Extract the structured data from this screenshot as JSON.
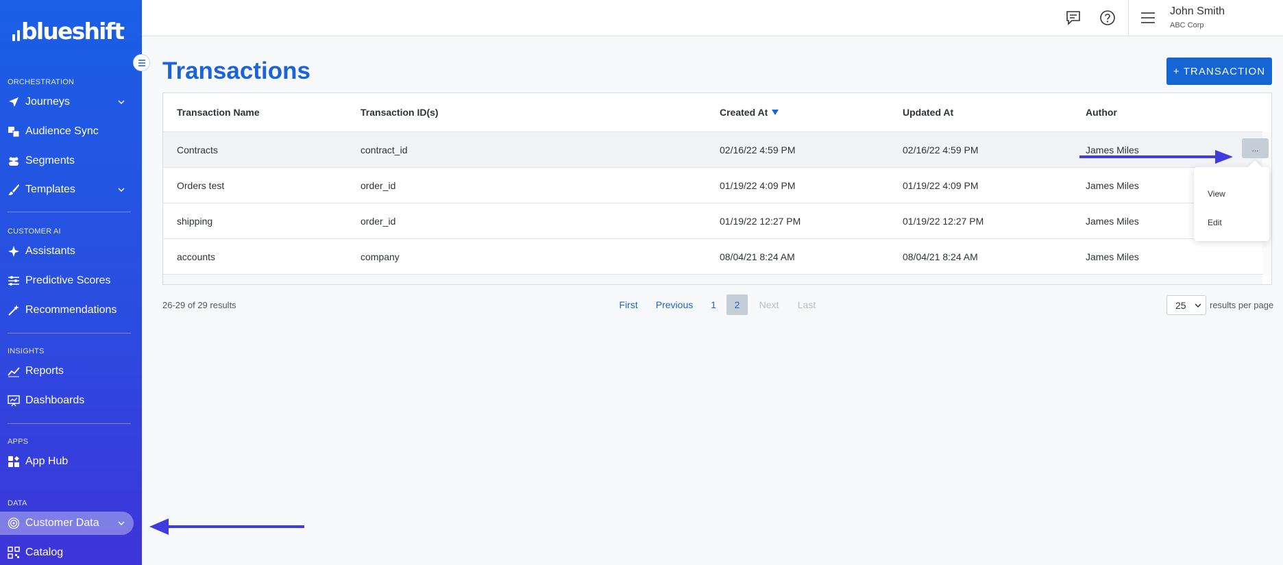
{
  "brand": {
    "logo_text": "blueshift"
  },
  "sidebar": {
    "sections": {
      "orchestration": "ORCHESTRATION",
      "customer_ai": "CUSTOMER AI",
      "insights": "INSIGHTS",
      "apps": "APPS",
      "data": "DATA"
    },
    "items": [
      {
        "label": "Journeys",
        "icon": "send-icon",
        "has_chevron": true
      },
      {
        "label": "Audience Sync",
        "icon": "audience-sync-icon",
        "has_chevron": false
      },
      {
        "label": "Segments",
        "icon": "users-icon",
        "has_chevron": false
      },
      {
        "label": "Templates",
        "icon": "brush-icon",
        "has_chevron": true
      },
      {
        "label": "Assistants",
        "icon": "sparkle-icon",
        "has_chevron": false
      },
      {
        "label": "Predictive Scores",
        "icon": "sliders-icon",
        "has_chevron": false
      },
      {
        "label": "Recommendations",
        "icon": "magic-wand-icon",
        "has_chevron": false
      },
      {
        "label": "Reports",
        "icon": "line-chart-icon",
        "has_chevron": false
      },
      {
        "label": "Dashboards",
        "icon": "dashboard-icon",
        "has_chevron": false
      },
      {
        "label": "App Hub",
        "icon": "apps-icon",
        "has_chevron": false
      },
      {
        "label": "Customer Data",
        "icon": "fingerprint-icon",
        "has_chevron": true,
        "active": true
      },
      {
        "label": "Catalog",
        "icon": "qr-icon",
        "has_chevron": false
      }
    ]
  },
  "header": {
    "user_name": "John Smith",
    "user_org": "ABC Corp",
    "icons": [
      "feedback-icon",
      "help-icon",
      "menu-icon"
    ]
  },
  "page": {
    "title": "Transactions",
    "add_button": "+ TRANSACTION"
  },
  "table": {
    "columns": [
      "Transaction Name",
      "Transaction ID(s)",
      "Created At",
      "Updated At",
      "Author"
    ],
    "sorted_column": "Created At",
    "sort_direction": "desc",
    "rows": [
      [
        "Contracts",
        "contract_id",
        "02/16/22 4:59 PM",
        "02/16/22 4:59 PM",
        "James Miles"
      ],
      [
        "Orders test",
        "order_id",
        "01/19/22 4:09 PM",
        "01/19/22 4:09 PM",
        "James Miles"
      ],
      [
        "shipping",
        "order_id",
        "01/19/22 12:27 PM",
        "01/19/22 12:27 PM",
        "James Miles"
      ],
      [
        "accounts",
        "company",
        "08/04/21 8:24 AM",
        "08/04/21 8:24 AM",
        "James Miles"
      ]
    ],
    "row_actions_label": "...",
    "row_menu": [
      "View",
      "Edit"
    ]
  },
  "pagination": {
    "summary": "26-29 of 29 results",
    "first": "First",
    "previous": "Previous",
    "pages": [
      "1",
      "2"
    ],
    "current_page": "2",
    "next": "Next",
    "last": "Last",
    "per_page": "25",
    "per_page_label": "results per page"
  },
  "colors": {
    "primary": "#1566d4",
    "sidebar_top": "#1a5fe6",
    "sidebar_bottom": "#3e34d8",
    "annotation_arrow": "#3f3ddf"
  }
}
